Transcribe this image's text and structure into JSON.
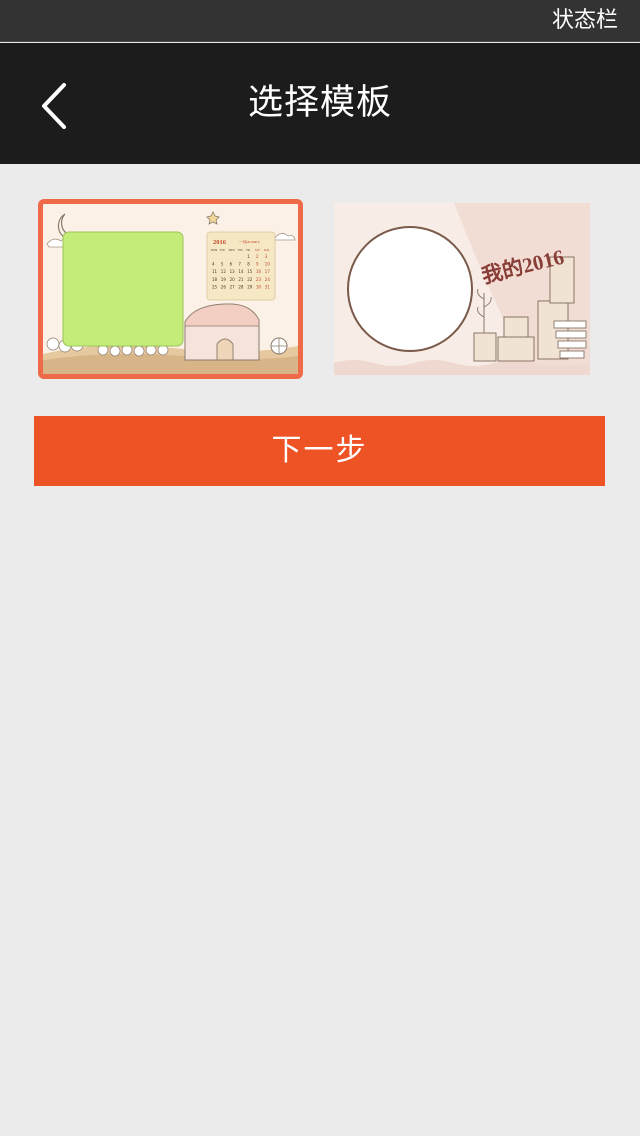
{
  "status_bar": {
    "label": "状态栏"
  },
  "nav": {
    "title": "选择模板",
    "back_icon": "chevron-left-icon"
  },
  "templates": [
    {
      "selected": true,
      "calendar_year": "2016",
      "calendar_month": "一月January",
      "weekday_headers": [
        "MON",
        "TUE",
        "WED",
        "THU",
        "FRI",
        "SAT",
        "SUN"
      ],
      "calendar_days": [
        "1",
        "2",
        "3",
        "4",
        "5",
        "6",
        "7",
        "8",
        "9",
        "10",
        "11",
        "12",
        "13",
        "14",
        "15",
        "16",
        "17",
        "18",
        "19",
        "20",
        "21",
        "22",
        "23",
        "24",
        "25",
        "26",
        "27",
        "28",
        "29",
        "30",
        "31"
      ]
    },
    {
      "selected": false,
      "title_text": "我的2016"
    }
  ],
  "next_button": {
    "label": "下一步"
  },
  "colors": {
    "accent": "#ee5326",
    "selected_border": "#ef6a48",
    "nav_bg": "#1c1c1c",
    "status_bg": "#333333",
    "page_bg": "#ebebeb",
    "photo_slot": "#c3ed78"
  }
}
